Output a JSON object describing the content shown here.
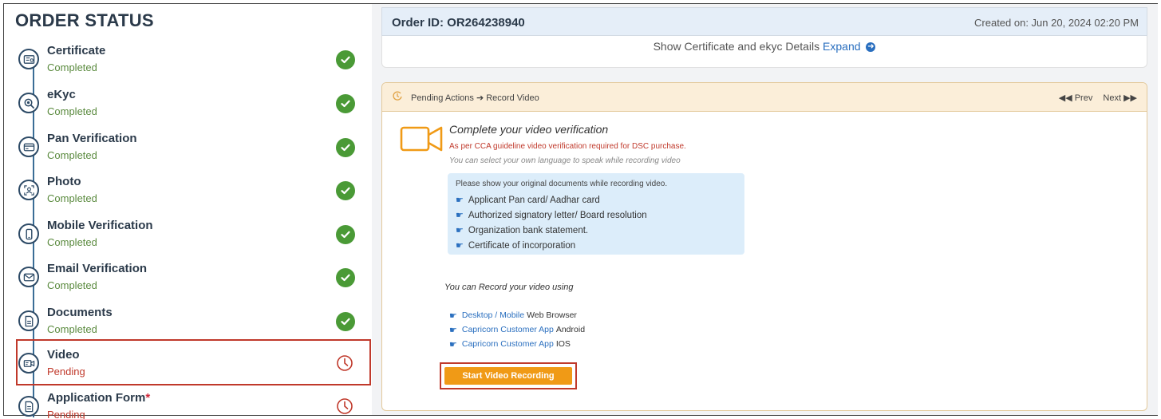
{
  "left": {
    "title": "ORDER STATUS",
    "steps": [
      {
        "name": "Certificate",
        "status": "Completed",
        "icon": "certificate-icon",
        "state": "completed"
      },
      {
        "name": "eKyc",
        "status": "Completed",
        "icon": "magnifier-icon",
        "state": "completed"
      },
      {
        "name": "Pan Verification",
        "status": "Completed",
        "icon": "card-icon",
        "state": "completed"
      },
      {
        "name": "Photo",
        "status": "Completed",
        "icon": "photo-icon",
        "state": "completed"
      },
      {
        "name": "Mobile Verification",
        "status": "Completed",
        "icon": "mobile-icon",
        "state": "completed"
      },
      {
        "name": "Email Verification",
        "status": "Completed",
        "icon": "email-icon",
        "state": "completed"
      },
      {
        "name": "Documents",
        "status": "Completed",
        "icon": "document-icon",
        "state": "completed"
      },
      {
        "name": "Video",
        "status": "Pending",
        "icon": "video-icon",
        "state": "pending"
      },
      {
        "name": "Application Form",
        "required": "*",
        "status": "Pending",
        "icon": "form-icon",
        "state": "pending"
      }
    ]
  },
  "order": {
    "id": "Order ID: OR264238940",
    "created": "Created on: Jun 20, 2024 02:20 PM",
    "cert_text": "Show Certificate and ekyc Details",
    "expand": "Expand"
  },
  "pending": {
    "label": "Pending Actions",
    "arrow": "➔",
    "current": "Record Video",
    "prev": "◀◀ Prev",
    "next": "Next ▶▶"
  },
  "video": {
    "title": "Complete your video verification",
    "note1": "As per CCA guideline video verification required for DSC purchase.",
    "note2": "You can select your own language to speak while recording video",
    "doc_intro": "Please show your original documents while recording video.",
    "docs": [
      "Applicant Pan card/ Aadhar card",
      "Authorized signatory letter/ Board resolution",
      "Organization bank statement.",
      "Certificate of incorporation"
    ],
    "record_using": "You can Record your video using",
    "record_options": [
      {
        "link": "Desktop / Mobile",
        "text": "Web Browser"
      },
      {
        "link": "Capricorn Customer App",
        "text": "Android"
      },
      {
        "link": "Capricorn Customer App",
        "text": "IOS"
      }
    ],
    "start_button": "Start Video Recording"
  },
  "colors": {
    "completed": "#4a9a36",
    "pending": "#c0392b",
    "accent_orange": "#f09a16",
    "link_blue": "#2a6fbf"
  }
}
